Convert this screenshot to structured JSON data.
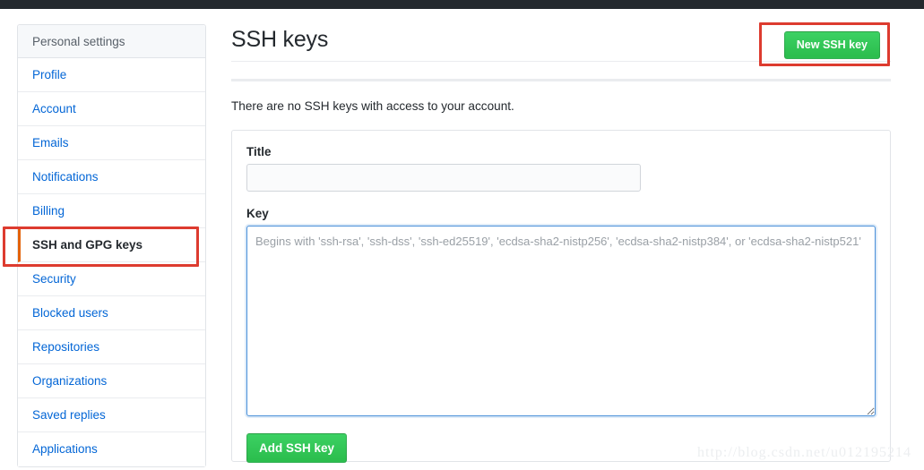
{
  "window": {
    "top_bar_color": "#24292e"
  },
  "sidebar": {
    "heading": "Personal settings",
    "items": [
      {
        "label": "Profile",
        "selected": false
      },
      {
        "label": "Account",
        "selected": false
      },
      {
        "label": "Emails",
        "selected": false
      },
      {
        "label": "Notifications",
        "selected": false
      },
      {
        "label": "Billing",
        "selected": false
      },
      {
        "label": "SSH and GPG keys",
        "selected": true
      },
      {
        "label": "Security",
        "selected": false
      },
      {
        "label": "Blocked users",
        "selected": false
      },
      {
        "label": "Repositories",
        "selected": false
      },
      {
        "label": "Organizations",
        "selected": false
      },
      {
        "label": "Saved replies",
        "selected": false
      },
      {
        "label": "Applications",
        "selected": false
      }
    ]
  },
  "main": {
    "title": "SSH keys",
    "new_key_button": "New SSH key",
    "empty_message": "There are no SSH keys with access to your account.",
    "form": {
      "title_label": "Title",
      "title_value": "",
      "title_placeholder": "",
      "key_label": "Key",
      "key_value": "",
      "key_placeholder": "Begins with 'ssh-rsa', 'ssh-dss', 'ssh-ed25519', 'ecdsa-sha2-nistp256', 'ecdsa-sha2-nistp384', or 'ecdsa-sha2-nistp521'",
      "submit_button": "Add SSH key"
    }
  },
  "annotations": {
    "color": "#dd3b2f",
    "selected_item_highlight": "SSH and GPG keys",
    "button_highlight": "New SSH key"
  },
  "watermark": {
    "text": "http://blog.csdn.net/u012195214"
  }
}
